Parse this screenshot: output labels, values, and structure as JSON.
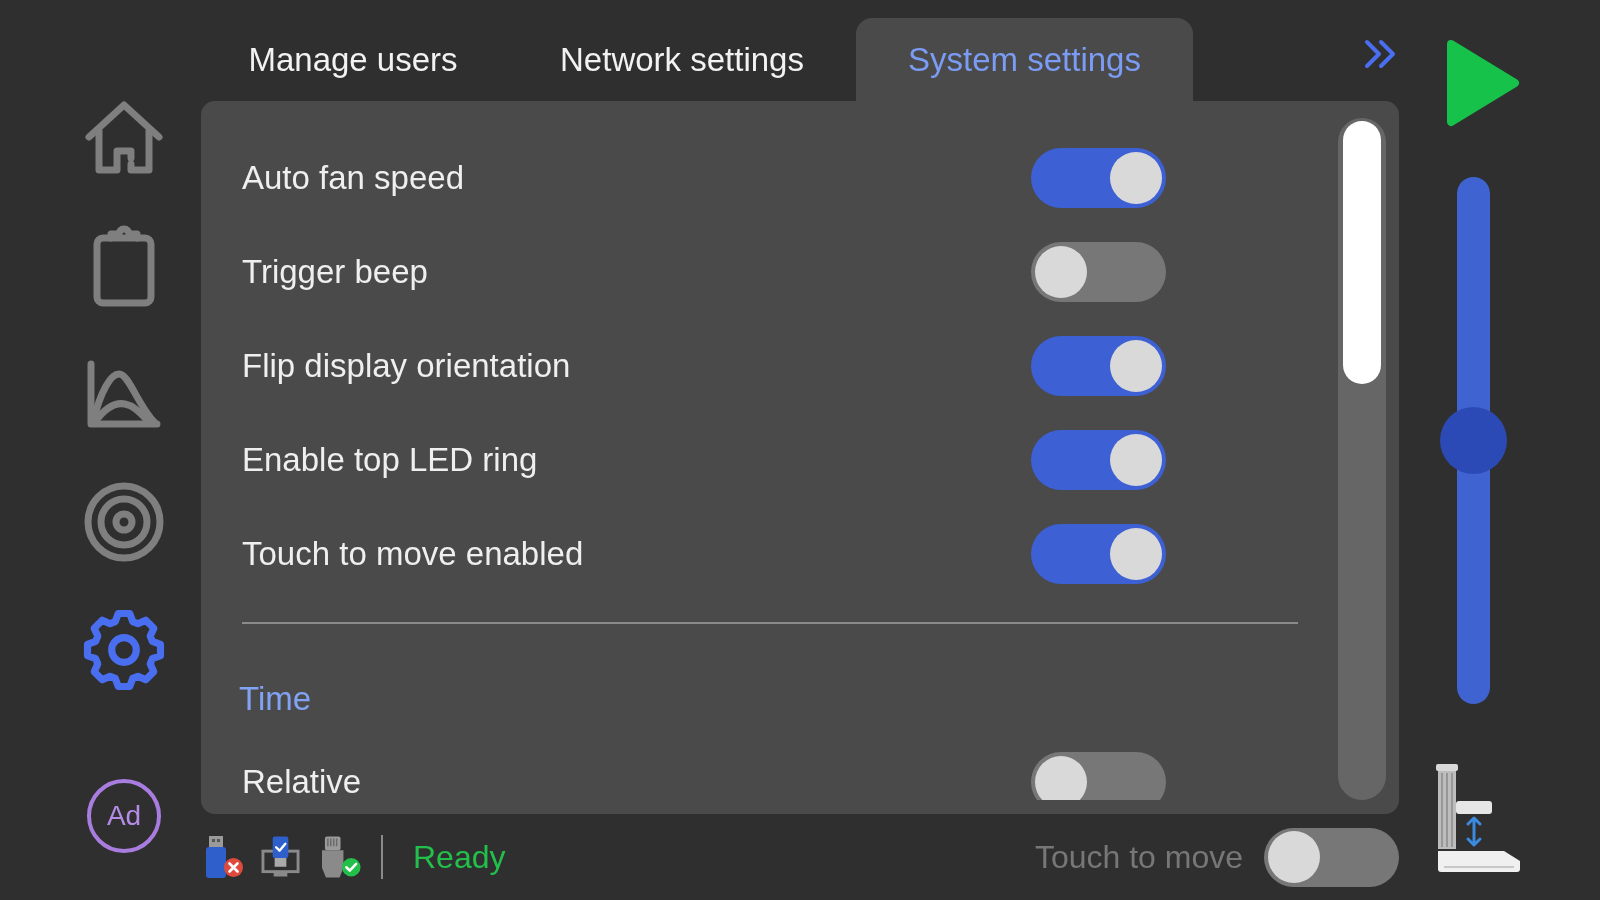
{
  "tabs": [
    {
      "label": "Manage users",
      "selected": false
    },
    {
      "label": "Network settings",
      "selected": false
    },
    {
      "label": "System settings",
      "selected": true
    }
  ],
  "sidebar": {
    "items": [
      {
        "selected": false
      },
      {
        "selected": false
      },
      {
        "selected": false
      },
      {
        "selected": false
      },
      {
        "selected": true
      }
    ],
    "avatar": {
      "initials": "Ad"
    }
  },
  "settings": {
    "sections": [
      {
        "rows": [
          {
            "label": "Auto fan speed",
            "on": true
          },
          {
            "label": "Trigger beep",
            "on": false
          },
          {
            "label": "Flip display orientation",
            "on": true
          },
          {
            "label": "Enable top LED ring",
            "on": true
          },
          {
            "label": "Touch to move enabled",
            "on": true
          }
        ]
      },
      {
        "title": "Time",
        "rows": [
          {
            "label": "Relative",
            "on": false
          }
        ]
      }
    ]
  },
  "status_bar": {
    "devices": [
      {
        "connected": false
      },
      {
        "connected": true
      },
      {
        "connected": true
      }
    ],
    "status": "Ready",
    "touch_to_move": {
      "label": "Touch to move",
      "on": false
    }
  },
  "focus_slider": {
    "level": 0.5
  }
}
